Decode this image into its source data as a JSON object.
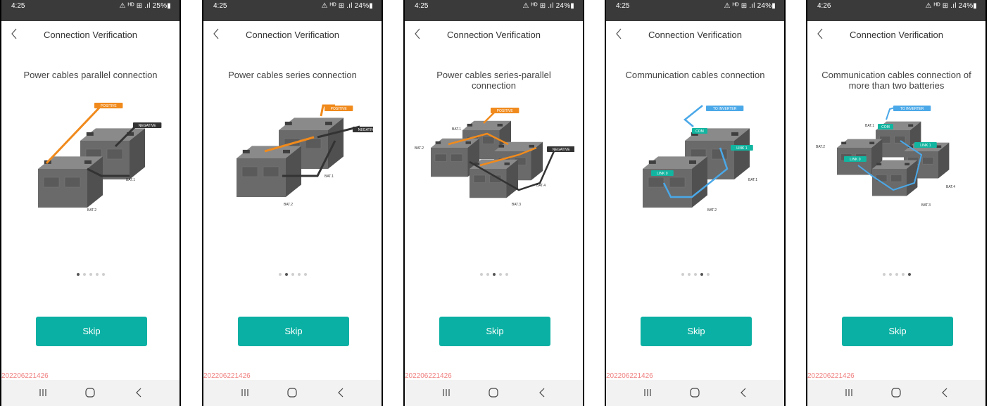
{
  "screens": [
    {
      "status": {
        "time": "4:25",
        "indicators": "⚠ ᴴᴰ ⊞ .ıl 25%▮"
      },
      "title": "Connection Verification",
      "caption": "Power cables parallel connection",
      "active_dot": 0,
      "diagram": {
        "tags": [
          "POSITIVE",
          "NEGATIVE"
        ],
        "labels": [
          "BAT.1",
          "BAT.2"
        ]
      },
      "skip_label": "Skip",
      "version": "202206221426"
    },
    {
      "status": {
        "time": "4:25",
        "indicators": "⚠ ᴴᴰ ⊞ .ıl 24%▮"
      },
      "title": "Connection Verification",
      "caption": "Power cables series connection",
      "active_dot": 1,
      "diagram": {
        "tags": [
          "POSITIVE",
          "NEGATIVE"
        ],
        "labels": [
          "BAT.1",
          "BAT.2"
        ]
      },
      "skip_label": "Skip",
      "version": "202206221426"
    },
    {
      "status": {
        "time": "4:25",
        "indicators": "⚠ ᴴᴰ ⊞ .ıl 24%▮"
      },
      "title": "Connection Verification",
      "caption": "Power cables series-parallel connection",
      "active_dot": 2,
      "diagram": {
        "tags": [
          "POSITIVE",
          "NEGATIVE"
        ],
        "labels": [
          "BAT.1",
          "BAT.2",
          "BAT.3",
          "BAT.4"
        ]
      },
      "skip_label": "Skip",
      "version": "202206221426"
    },
    {
      "status": {
        "time": "4:25",
        "indicators": "⚠ ᴴᴰ ⊞ .ıl 24%▮"
      },
      "title": "Connection Verification",
      "caption": "Communication cables connection",
      "active_dot": 3,
      "diagram": {
        "tags": [
          "TO INVERTER",
          "COM",
          "LINK 1",
          "LINK 0"
        ],
        "labels": [
          "BAT.1",
          "BAT.2"
        ]
      },
      "skip_label": "Skip",
      "version": "202206221426"
    },
    {
      "status": {
        "time": "4:26",
        "indicators": "⚠ ᴴᴰ ⊞ .ıl 24%▮"
      },
      "title": "Connection Verification",
      "caption": "Communication cables connection of more than two batteries",
      "active_dot": 4,
      "diagram": {
        "tags": [
          "TO INVERTER",
          "COM",
          "LINK 1",
          "LINK 0"
        ],
        "labels": [
          "BAT.1",
          "BAT.2",
          "BAT.3",
          "BAT.4"
        ]
      },
      "skip_label": "Skip",
      "version": "202206221426"
    }
  ],
  "dots_count": 5,
  "colors": {
    "accent": "#0ab0a3",
    "positive_cable": "#f08a1c",
    "negative_cable": "#333333",
    "comm_cable": "#4aa8e8",
    "link_tag": "#12b5a0",
    "version_text": "#f08080",
    "status_bar": "#3a3a3a"
  },
  "icons": {
    "back": "chevron-left-icon",
    "nav_recents": "recents-icon",
    "nav_home": "home-icon",
    "nav_back": "nav-back-icon"
  }
}
